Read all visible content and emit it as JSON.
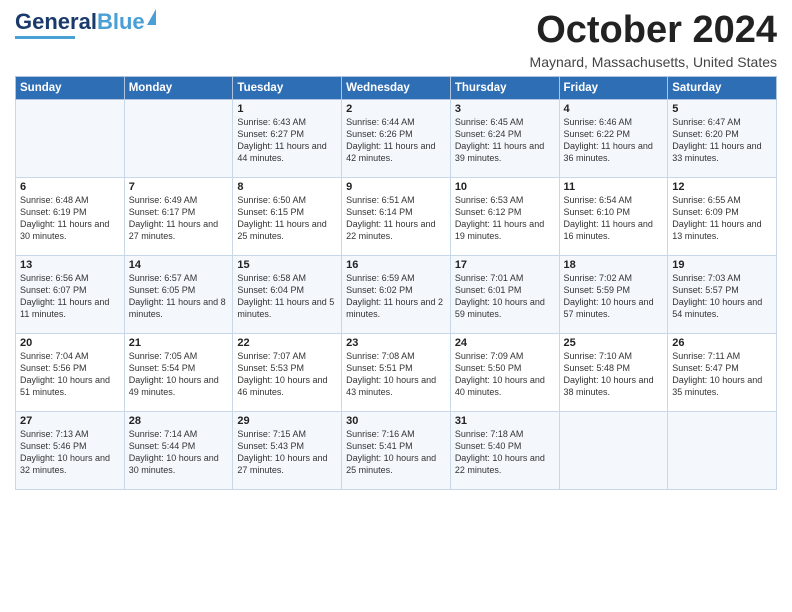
{
  "logo": {
    "line1": "General",
    "line2": "Blue"
  },
  "title": "October 2024",
  "location": "Maynard, Massachusetts, United States",
  "days_of_week": [
    "Sunday",
    "Monday",
    "Tuesday",
    "Wednesday",
    "Thursday",
    "Friday",
    "Saturday"
  ],
  "weeks": [
    [
      {
        "day": "",
        "info": ""
      },
      {
        "day": "",
        "info": ""
      },
      {
        "day": "1",
        "info": "Sunrise: 6:43 AM\nSunset: 6:27 PM\nDaylight: 11 hours and 44 minutes."
      },
      {
        "day": "2",
        "info": "Sunrise: 6:44 AM\nSunset: 6:26 PM\nDaylight: 11 hours and 42 minutes."
      },
      {
        "day": "3",
        "info": "Sunrise: 6:45 AM\nSunset: 6:24 PM\nDaylight: 11 hours and 39 minutes."
      },
      {
        "day": "4",
        "info": "Sunrise: 6:46 AM\nSunset: 6:22 PM\nDaylight: 11 hours and 36 minutes."
      },
      {
        "day": "5",
        "info": "Sunrise: 6:47 AM\nSunset: 6:20 PM\nDaylight: 11 hours and 33 minutes."
      }
    ],
    [
      {
        "day": "6",
        "info": "Sunrise: 6:48 AM\nSunset: 6:19 PM\nDaylight: 11 hours and 30 minutes."
      },
      {
        "day": "7",
        "info": "Sunrise: 6:49 AM\nSunset: 6:17 PM\nDaylight: 11 hours and 27 minutes."
      },
      {
        "day": "8",
        "info": "Sunrise: 6:50 AM\nSunset: 6:15 PM\nDaylight: 11 hours and 25 minutes."
      },
      {
        "day": "9",
        "info": "Sunrise: 6:51 AM\nSunset: 6:14 PM\nDaylight: 11 hours and 22 minutes."
      },
      {
        "day": "10",
        "info": "Sunrise: 6:53 AM\nSunset: 6:12 PM\nDaylight: 11 hours and 19 minutes."
      },
      {
        "day": "11",
        "info": "Sunrise: 6:54 AM\nSunset: 6:10 PM\nDaylight: 11 hours and 16 minutes."
      },
      {
        "day": "12",
        "info": "Sunrise: 6:55 AM\nSunset: 6:09 PM\nDaylight: 11 hours and 13 minutes."
      }
    ],
    [
      {
        "day": "13",
        "info": "Sunrise: 6:56 AM\nSunset: 6:07 PM\nDaylight: 11 hours and 11 minutes."
      },
      {
        "day": "14",
        "info": "Sunrise: 6:57 AM\nSunset: 6:05 PM\nDaylight: 11 hours and 8 minutes."
      },
      {
        "day": "15",
        "info": "Sunrise: 6:58 AM\nSunset: 6:04 PM\nDaylight: 11 hours and 5 minutes."
      },
      {
        "day": "16",
        "info": "Sunrise: 6:59 AM\nSunset: 6:02 PM\nDaylight: 11 hours and 2 minutes."
      },
      {
        "day": "17",
        "info": "Sunrise: 7:01 AM\nSunset: 6:01 PM\nDaylight: 10 hours and 59 minutes."
      },
      {
        "day": "18",
        "info": "Sunrise: 7:02 AM\nSunset: 5:59 PM\nDaylight: 10 hours and 57 minutes."
      },
      {
        "day": "19",
        "info": "Sunrise: 7:03 AM\nSunset: 5:57 PM\nDaylight: 10 hours and 54 minutes."
      }
    ],
    [
      {
        "day": "20",
        "info": "Sunrise: 7:04 AM\nSunset: 5:56 PM\nDaylight: 10 hours and 51 minutes."
      },
      {
        "day": "21",
        "info": "Sunrise: 7:05 AM\nSunset: 5:54 PM\nDaylight: 10 hours and 49 minutes."
      },
      {
        "day": "22",
        "info": "Sunrise: 7:07 AM\nSunset: 5:53 PM\nDaylight: 10 hours and 46 minutes."
      },
      {
        "day": "23",
        "info": "Sunrise: 7:08 AM\nSunset: 5:51 PM\nDaylight: 10 hours and 43 minutes."
      },
      {
        "day": "24",
        "info": "Sunrise: 7:09 AM\nSunset: 5:50 PM\nDaylight: 10 hours and 40 minutes."
      },
      {
        "day": "25",
        "info": "Sunrise: 7:10 AM\nSunset: 5:48 PM\nDaylight: 10 hours and 38 minutes."
      },
      {
        "day": "26",
        "info": "Sunrise: 7:11 AM\nSunset: 5:47 PM\nDaylight: 10 hours and 35 minutes."
      }
    ],
    [
      {
        "day": "27",
        "info": "Sunrise: 7:13 AM\nSunset: 5:46 PM\nDaylight: 10 hours and 32 minutes."
      },
      {
        "day": "28",
        "info": "Sunrise: 7:14 AM\nSunset: 5:44 PM\nDaylight: 10 hours and 30 minutes."
      },
      {
        "day": "29",
        "info": "Sunrise: 7:15 AM\nSunset: 5:43 PM\nDaylight: 10 hours and 27 minutes."
      },
      {
        "day": "30",
        "info": "Sunrise: 7:16 AM\nSunset: 5:41 PM\nDaylight: 10 hours and 25 minutes."
      },
      {
        "day": "31",
        "info": "Sunrise: 7:18 AM\nSunset: 5:40 PM\nDaylight: 10 hours and 22 minutes."
      },
      {
        "day": "",
        "info": ""
      },
      {
        "day": "",
        "info": ""
      }
    ]
  ]
}
